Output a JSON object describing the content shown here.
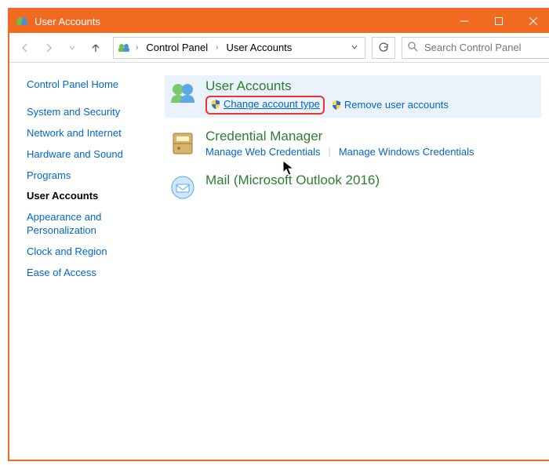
{
  "title": "User Accounts",
  "breadcrumb": {
    "root": "Control Panel",
    "current": "User Accounts"
  },
  "search": {
    "placeholder": "Search Control Panel"
  },
  "sidebar": {
    "home": "Control Panel Home",
    "items": [
      "System and Security",
      "Network and Internet",
      "Hardware and Sound",
      "Programs",
      "User Accounts",
      "Appearance and Personalization",
      "Clock and Region",
      "Ease of Access"
    ]
  },
  "categories": {
    "user_accounts": {
      "title": "User Accounts",
      "change_type": "Change account type",
      "remove": "Remove user accounts"
    },
    "credential_manager": {
      "title": "Credential Manager",
      "web": "Manage Web Credentials",
      "windows": "Manage Windows Credentials"
    },
    "mail": {
      "title": "Mail (Microsoft Outlook 2016)"
    }
  }
}
